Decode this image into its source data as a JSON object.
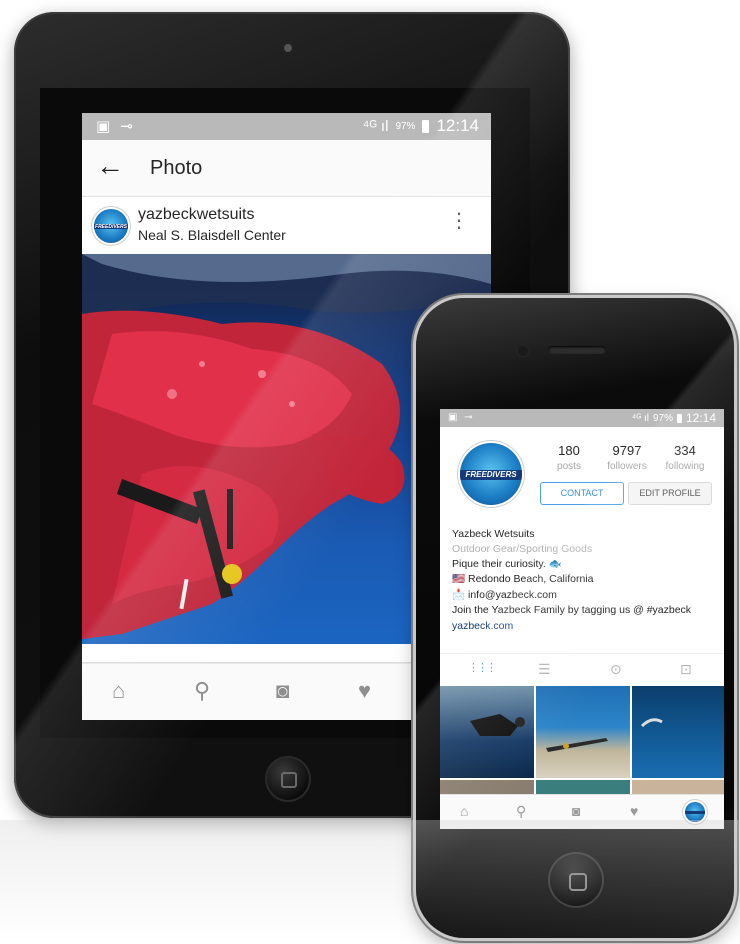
{
  "tablet": {
    "status_left": "▣ ⊸",
    "status_signal": "⁴ᴳ ıl",
    "status_battery": "97%",
    "status_time": "12:14",
    "back_icon": "←",
    "header_title": "Photo",
    "post_username": "yazbeckwetsuits",
    "post_location": "Neal S. Blaisdell Center",
    "avatar_text": "FREEDIVERS",
    "more_icon": "⋮",
    "nav_icons": {
      "home": "⌂",
      "search": "⚲",
      "camera": "◙",
      "heart": "♥"
    }
  },
  "phone": {
    "status_left": "▣ ⊸",
    "status_signal": "⁴ᴳ ıl",
    "status_battery": "97%",
    "status_time": "12:14",
    "avatar_text": "FREEDIVERS",
    "stats": [
      {
        "number": "180",
        "label": "posts"
      },
      {
        "number": "9797",
        "label": "followers"
      },
      {
        "number": "334",
        "label": "following"
      }
    ],
    "contact_label": "CONTACT",
    "edit_profile_label": "EDIT PROFILE",
    "bio": {
      "name": "Yazbeck Wetsuits",
      "category": "Outdoor Gear/Sporting Goods",
      "line1": "Pique their curiosity. 🐟",
      "line2": "🇺🇸 Redondo Beach, California",
      "line3": "📩 info@yazbeck.com",
      "line4": "Join the Yazbeck Family by tagging us @ #yazbeck",
      "website": "yazbeck.com"
    },
    "profile_tab_icons": {
      "grid": "⋮⋮⋮",
      "list": "☰",
      "location": "⊙",
      "tagged": "⊡"
    },
    "nav_icons": {
      "home": "⌂",
      "search": "⚲",
      "camera": "◙",
      "heart": "♥"
    }
  }
}
